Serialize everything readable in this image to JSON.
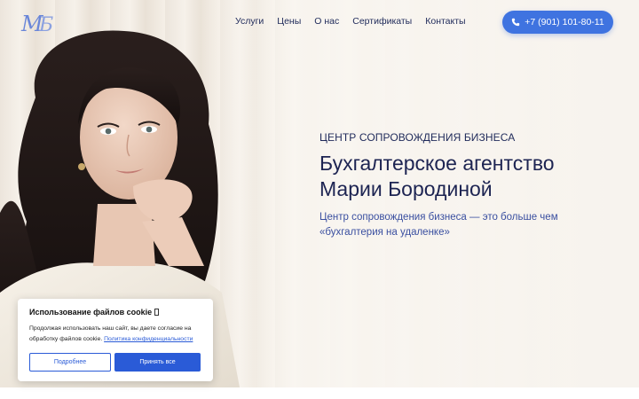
{
  "brand": {
    "logo_text": "МБ",
    "logo_color": "#6a86d8"
  },
  "nav": {
    "items": [
      {
        "label": "Услуги"
      },
      {
        "label": "Цены"
      },
      {
        "label": "О нас"
      },
      {
        "label": "Сертификаты"
      },
      {
        "label": "Контакты"
      }
    ]
  },
  "header": {
    "phone": "+7 (901) 101-80-11",
    "phone_icon": "phone-icon",
    "accent_color": "#3f73e0"
  },
  "hero": {
    "eyebrow": "ЦЕНТР СОПРОВОЖДЕНИЯ БИЗНЕСА",
    "title_line1": "Бухгалтерское агентство",
    "title_line2": "Марии Бородиной",
    "subtitle_line1": "Центр сопровождения бизнеса — это больше чем",
    "subtitle_line2": "«бухгалтерия на удаленке»"
  },
  "cookie": {
    "title": "Использование файлов cookie",
    "text": "Продолжая использовать наш сайт, вы даете согласие на обработку файлов cookie.",
    "link": "Политика конфиденциальности",
    "more_button": "Подробнее",
    "accept_button": "Принять все"
  }
}
